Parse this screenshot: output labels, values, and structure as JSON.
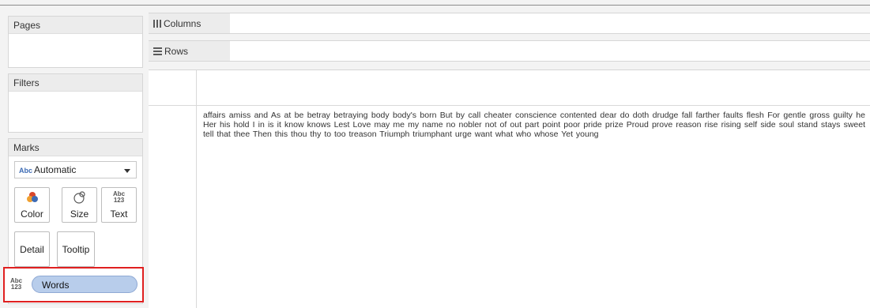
{
  "left_panel": {
    "pages_title": "Pages",
    "filters_title": "Filters",
    "marks": {
      "title": "Marks",
      "mark_type": "Automatic",
      "mark_type_abc": "Abc",
      "buttons": {
        "color": "Color",
        "size": "Size",
        "text": "Text",
        "detail": "Detail",
        "tooltip": "Tooltip"
      },
      "field_pill": "Words",
      "pill_icon_top": "Abc",
      "pill_icon_bottom": "123"
    }
  },
  "shelves": {
    "columns": "Columns",
    "rows": "Rows"
  },
  "view": {
    "words": "affairs amiss and As at be betray betraying body body's born But by call cheater conscience contented dear do doth drudge fall farther faults flesh For gentle gross guilty he Her his hold I in is it know knows Lest Love may me my name no nobler not of out part point poor pride prize Proud prove reason rise rising self side soul stand stays sweet tell that thee Then this thou thy to too treason Triumph triumphant urge want what who whose Yet young"
  },
  "colors": {
    "pill_fill": "#b8cdeb",
    "highlight_border": "#e02020",
    "color_icon_red": "#d9472b",
    "color_icon_orange": "#f0a030",
    "color_icon_blue": "#3e6cb5"
  }
}
